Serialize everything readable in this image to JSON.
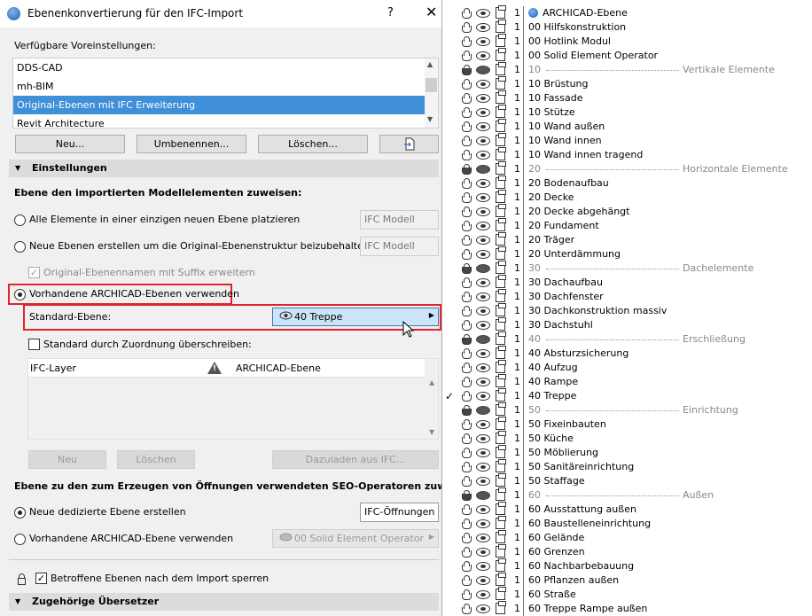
{
  "dialog": {
    "title": "Ebenenkonvertierung für den IFC-Import",
    "help": "?",
    "close": "✕",
    "presets_label": "Verfügbare Voreinstellungen:",
    "presets": [
      "DDS-CAD",
      "mh-BIM",
      "Original-Ebenen mit IFC Erweiterung",
      "Revit Architecture"
    ],
    "selected_preset": "Original-Ebenen mit IFC Erweiterung",
    "btn_new": "Neu...",
    "btn_rename": "Umbenennen...",
    "btn_delete": "Löschen...",
    "settings_section": "Einstellungen",
    "assign_heading": "Ebene den importierten Modellelementen zuweisen:",
    "opt_single_layer": "Alle Elemente in einer einzigen neuen Ebene platzieren",
    "opt_single_layer_value": "IFC Modell",
    "opt_new_layers": "Neue Ebenen erstellen um die Original-Ebenenstruktur beizubehalten",
    "opt_new_layers_value": "IFC Modell",
    "suffix_checkbox": "Original-Ebenennamen mit Suffix erweitern",
    "opt_existing": "Vorhandene ARCHICAD-Ebenen verwenden",
    "default_layer_label": "Standard-Ebene:",
    "default_layer_value": "40 Treppe",
    "override_checkbox": "Standard durch Zuordnung überschreiben:",
    "col_ifc_layer": "IFC-Layer",
    "col_archicad_layer": "ARCHICAD-Ebene",
    "btn_map_new": "Neu",
    "btn_map_delete": "Löschen",
    "btn_load_from_ifc": "Dazuladen aus IFC...",
    "seo_heading": "Ebene zu den zum Erzeugen von Öffnungen verwendeten SEO-Operatoren zuweisen:",
    "seo_opt_new": "Neue dedizierte Ebene erstellen",
    "seo_opt_new_value": "IFC-Öffnungen",
    "seo_opt_existing": "Vorhandene ARCHICAD-Ebene verwenden",
    "seo_opt_existing_value": "00 Solid Element Operator",
    "lock_checkbox": "Betroffene Ebenen nach dem Import sperren",
    "translator_section": "Zugehörige Übersetzer"
  },
  "layers": [
    {
      "num": "1",
      "name": "ARCHICAD-Ebene",
      "header": true
    },
    {
      "num": "1",
      "name": "00 Hilfskonstruktion"
    },
    {
      "num": "1",
      "name": "00 Hotlink Modul"
    },
    {
      "num": "1",
      "name": "00 Solid Element Operator"
    },
    {
      "num": "1",
      "name": "10",
      "group": "Vertikale Elemente"
    },
    {
      "num": "1",
      "name": "10 Brüstung"
    },
    {
      "num": "1",
      "name": "10 Fassade"
    },
    {
      "num": "1",
      "name": "10 Stütze"
    },
    {
      "num": "1",
      "name": "10 Wand außen"
    },
    {
      "num": "1",
      "name": "10 Wand innen"
    },
    {
      "num": "1",
      "name": "10 Wand innen tragend"
    },
    {
      "num": "1",
      "name": "20",
      "group": "Horizontale Elemente"
    },
    {
      "num": "1",
      "name": "20 Bodenaufbau"
    },
    {
      "num": "1",
      "name": "20 Decke"
    },
    {
      "num": "1",
      "name": "20 Decke abgehängt"
    },
    {
      "num": "1",
      "name": "20 Fundament"
    },
    {
      "num": "1",
      "name": "20 Träger"
    },
    {
      "num": "1",
      "name": "20 Unterdämmung"
    },
    {
      "num": "1",
      "name": "30",
      "group": "Dachelemente"
    },
    {
      "num": "1",
      "name": "30 Dachaufbau"
    },
    {
      "num": "1",
      "name": "30 Dachfenster"
    },
    {
      "num": "1",
      "name": "30 Dachkonstruktion massiv"
    },
    {
      "num": "1",
      "name": "30 Dachstuhl"
    },
    {
      "num": "1",
      "name": "40",
      "group": "Erschließung"
    },
    {
      "num": "1",
      "name": "40 Absturzsicherung"
    },
    {
      "num": "1",
      "name": "40 Aufzug"
    },
    {
      "num": "1",
      "name": "40 Rampe"
    },
    {
      "num": "1",
      "name": "40 Treppe",
      "checked": true
    },
    {
      "num": "1",
      "name": "50",
      "group": "Einrichtung"
    },
    {
      "num": "1",
      "name": "50 Fixeinbauten"
    },
    {
      "num": "1",
      "name": "50 Küche"
    },
    {
      "num": "1",
      "name": "50 Möblierung"
    },
    {
      "num": "1",
      "name": "50 Sanitäreinrichtung"
    },
    {
      "num": "1",
      "name": "50 Staffage"
    },
    {
      "num": "1",
      "name": "60",
      "group": "Außen"
    },
    {
      "num": "1",
      "name": "60 Ausstattung außen"
    },
    {
      "num": "1",
      "name": "60 Baustelleneinrichtung"
    },
    {
      "num": "1",
      "name": "60 Gelände"
    },
    {
      "num": "1",
      "name": "60 Grenzen"
    },
    {
      "num": "1",
      "name": "60 Nachbarbebauung"
    },
    {
      "num": "1",
      "name": "60 Pflanzen außen"
    },
    {
      "num": "1",
      "name": "60 Straße"
    },
    {
      "num": "1",
      "name": "60 Treppe Rampe außen"
    }
  ],
  "colors": {
    "selection": "#3f8fd9",
    "highlight_box": "#e0242a",
    "popup_bg": "#cce4f7"
  }
}
